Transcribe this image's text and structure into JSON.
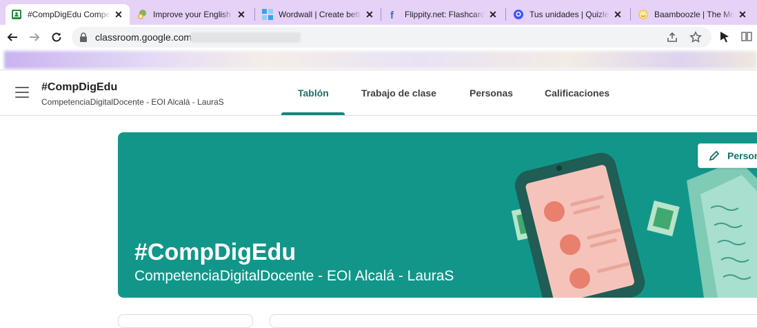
{
  "browser": {
    "tabs": [
      {
        "title": "#CompDigEdu Competencia",
        "icon": "classroom-icon",
        "active": true
      },
      {
        "title": "Improve your English playing",
        "icon": "globe-chat-icon"
      },
      {
        "title": "Wordwall | Create better lessons",
        "icon": "wordwall-icon"
      },
      {
        "title": "Flippity.net: Flashcards",
        "icon": "flippity-icon"
      },
      {
        "title": "Tus unidades | Quizlet",
        "icon": "quizlet-icon"
      },
      {
        "title": "Baamboozle | The Most",
        "icon": "baamboozle-icon"
      }
    ],
    "url": "classroom.google.com"
  },
  "classroom": {
    "class_name": "#CompDigEdu",
    "section": "CompetenciaDigitalDocente - EOI Alcalá - LauraS",
    "nav": [
      "Tablón",
      "Trabajo de clase",
      "Personas",
      "Calificaciones"
    ],
    "banner_title": "#CompDigEdu",
    "banner_subtitle": "CompetenciaDigitalDocente - EOI Alcalá - LauraS",
    "customize_label": "Person"
  },
  "colors": {
    "accent": "#12877a",
    "banner": "#12968a",
    "tabstrip": "#e6d1f7"
  }
}
